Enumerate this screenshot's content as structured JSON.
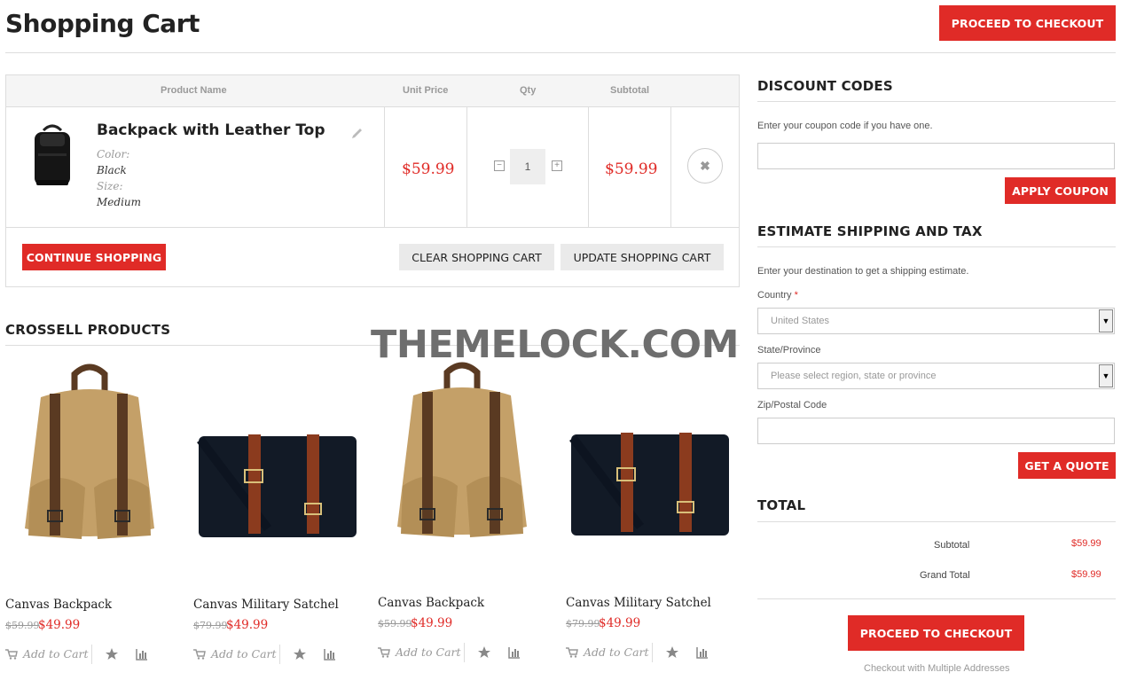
{
  "page": {
    "title": "Shopping Cart",
    "proceed_top": "PROCEED TO CHECKOUT"
  },
  "cart": {
    "headers": {
      "product": "Product Name",
      "price": "Unit Price",
      "qty": "Qty",
      "subtotal": "Subtotal"
    },
    "item": {
      "name": "Backpack with Leather Top",
      "color_label": "Color:",
      "color_value": "Black",
      "size_label": "Size:",
      "size_value": "Medium",
      "unit_price": "$59.99",
      "qty": "1",
      "subtotal": "$59.99"
    },
    "buttons": {
      "continue": "CONTINUE SHOPPING",
      "clear": "CLEAR SHOPPING CART",
      "update": "UPDATE SHOPPING CART"
    }
  },
  "crosssell": {
    "title": "CROSSELL PRODUCTS",
    "products": [
      {
        "name": "Canvas Backpack",
        "old_price": "$59.99",
        "price": "$49.99",
        "add_to_cart": "Add to Cart",
        "image": "canvas-backpack-image"
      },
      {
        "name": "Canvas Military Satchel",
        "old_price": "$79.99",
        "price": "$49.99",
        "add_to_cart": "Add to Cart",
        "image": "military-satchel-image"
      },
      {
        "name": "Canvas Backpack",
        "old_price": "$59.99",
        "price": "$49.99",
        "add_to_cart": "Add to Cart",
        "image": "canvas-backpack-image"
      },
      {
        "name": "Canvas Military Satchel",
        "old_price": "$79.99",
        "price": "$49.99",
        "add_to_cart": "Add to Cart",
        "image": "military-satchel-image"
      }
    ]
  },
  "watermark": "THEMELOCK.COM",
  "discount": {
    "title": "DISCOUNT CODES",
    "hint": "Enter your coupon code if you have one.",
    "input_value": "",
    "apply": "APPLY COUPON"
  },
  "shipping": {
    "title": "ESTIMATE SHIPPING AND TAX",
    "hint": "Enter your destination to get a shipping estimate.",
    "country_label": "Country",
    "required_mark": "*",
    "country_value": "United States",
    "state_label": "State/Province",
    "state_value": "Please select region, state or province",
    "zip_label": "Zip/Postal Code",
    "zip_value": "",
    "quote": "GET A QUOTE"
  },
  "totals": {
    "title": "TOTAL",
    "subtotal_label": "Subtotal",
    "subtotal_value": "$59.99",
    "grand_label": "Grand Total",
    "grand_value": "$59.99",
    "proceed": "PROCEED TO CHECKOUT",
    "multi": "Checkout with Multiple Addresses"
  },
  "colors": {
    "accent": "#e02b27",
    "border": "#dddddd",
    "header_bg": "#f5f5f5",
    "grey_button": "#eaeaea"
  }
}
